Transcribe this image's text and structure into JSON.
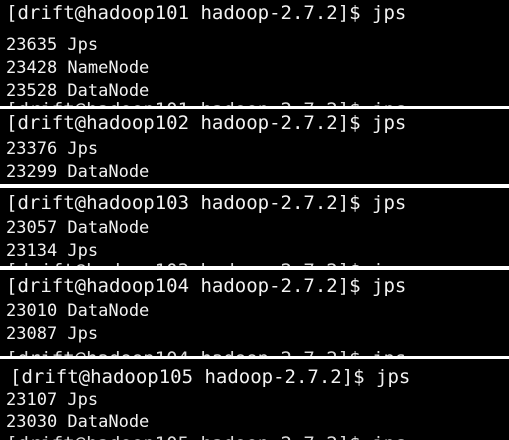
{
  "terminals": [
    {
      "host": "hadoop101",
      "prompt": "[drift@hadoop101 hadoop-2.7.2]$ jps",
      "lines": [
        "23635 Jps",
        "23428 NameNode",
        "23528 DataNode"
      ]
    },
    {
      "host": "hadoop102",
      "prompt": "[drift@hadoop102 hadoop-2.7.2]$ jps",
      "lines": [
        "23376 Jps",
        "23299 DataNode"
      ]
    },
    {
      "host": "hadoop103",
      "prompt": "[drift@hadoop103 hadoop-2.7.2]$ jps",
      "lines": [
        "23057 DataNode",
        "23134 Jps"
      ]
    },
    {
      "host": "hadoop104",
      "prompt": "[drift@hadoop104 hadoop-2.7.2]$ jps",
      "lines": [
        "23010 DataNode",
        "23087 Jps"
      ]
    },
    {
      "host": "hadoop105",
      "prompt": "[drift@hadoop105 hadoop-2.7.2]$ jps",
      "lines": [
        "23107 Jps",
        "23030 DataNode"
      ]
    }
  ],
  "colors": {
    "terminal_bg": "#000000",
    "terminal_text": "#f2f2f2",
    "gap": "#ffffff"
  }
}
